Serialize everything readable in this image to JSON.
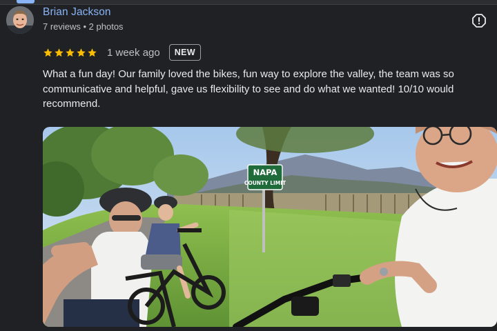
{
  "review": {
    "reviewer_name": "Brian Jackson",
    "reviewer_meta": "7 reviews • 2 photos",
    "rating": 5,
    "rating_max": 5,
    "date": "1 week ago",
    "badge": "NEW",
    "text": "What a fun day! Our family loved the bikes, fun way to explore the valley, the team was so communicative and helpful, gave us flexibility to see and do what we wanted! 10/10 would recommend."
  },
  "photo": {
    "sign_line1": "NAPA",
    "sign_line2": "COUNTY LIMIT"
  },
  "icons": {
    "report": "report-icon",
    "star": "star-icon"
  },
  "colors": {
    "background": "#202124",
    "name_link": "#8ab4f8",
    "star": "#fbbc04",
    "muted_text": "#bdc1c6"
  }
}
